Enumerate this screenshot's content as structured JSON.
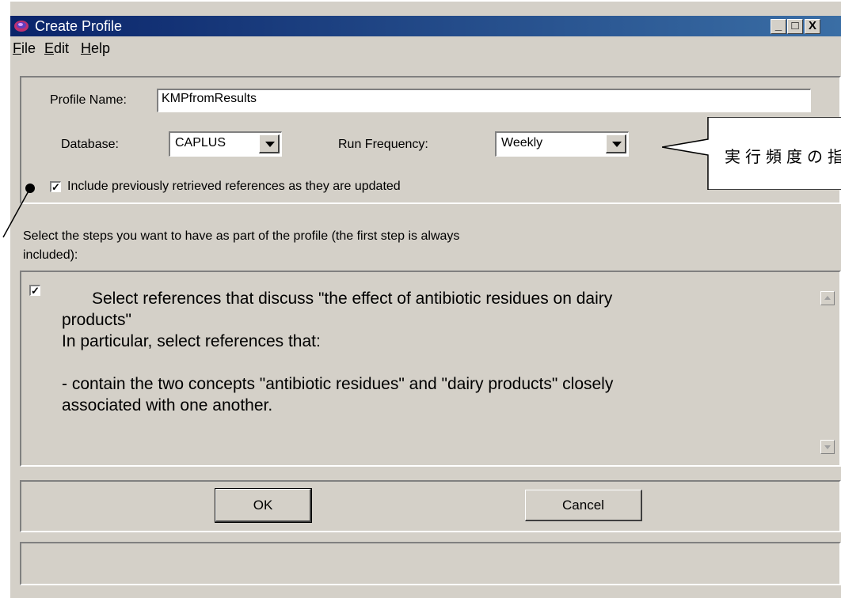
{
  "window": {
    "title": "Create Profile",
    "buttons": [
      "_",
      "□",
      "X"
    ]
  },
  "menu": [
    {
      "label": "File",
      "mnemonic": "F",
      "rest": "ile"
    },
    {
      "label": "Edit",
      "mnemonic": "E",
      "rest": "dit"
    },
    {
      "label": "Help",
      "mnemonic": "H",
      "rest": "elp"
    }
  ],
  "form": {
    "profile_name_label": "Profile Name:",
    "profile_name_value": "KMPfromResults",
    "database_label": "Database:",
    "database_value": "CAPLUS",
    "frequency_label": "Run Frequency:",
    "frequency_value": "Weekly",
    "include_checkbox_label": "Include previously retrieved references as they are updated",
    "include_checked": true
  },
  "steps": {
    "instruction": "Select the steps you want to have as part of the profile (the first step is always",
    "instruction_line2": "included):",
    "step1_checked": true,
    "lines": [
      "Select references that discuss \"the effect of antibiotic residues on dairy",
      "products\"",
      "In particular, select references that:",
      "",
      "- contain the two concepts \"antibiotic residues\" and \"dairy products\" closely",
      "associated with one another."
    ]
  },
  "actions": {
    "ok_label": "OK",
    "cancel_label": "Cancel"
  },
  "annotation": {
    "callout_text": "実行頻度の指"
  }
}
